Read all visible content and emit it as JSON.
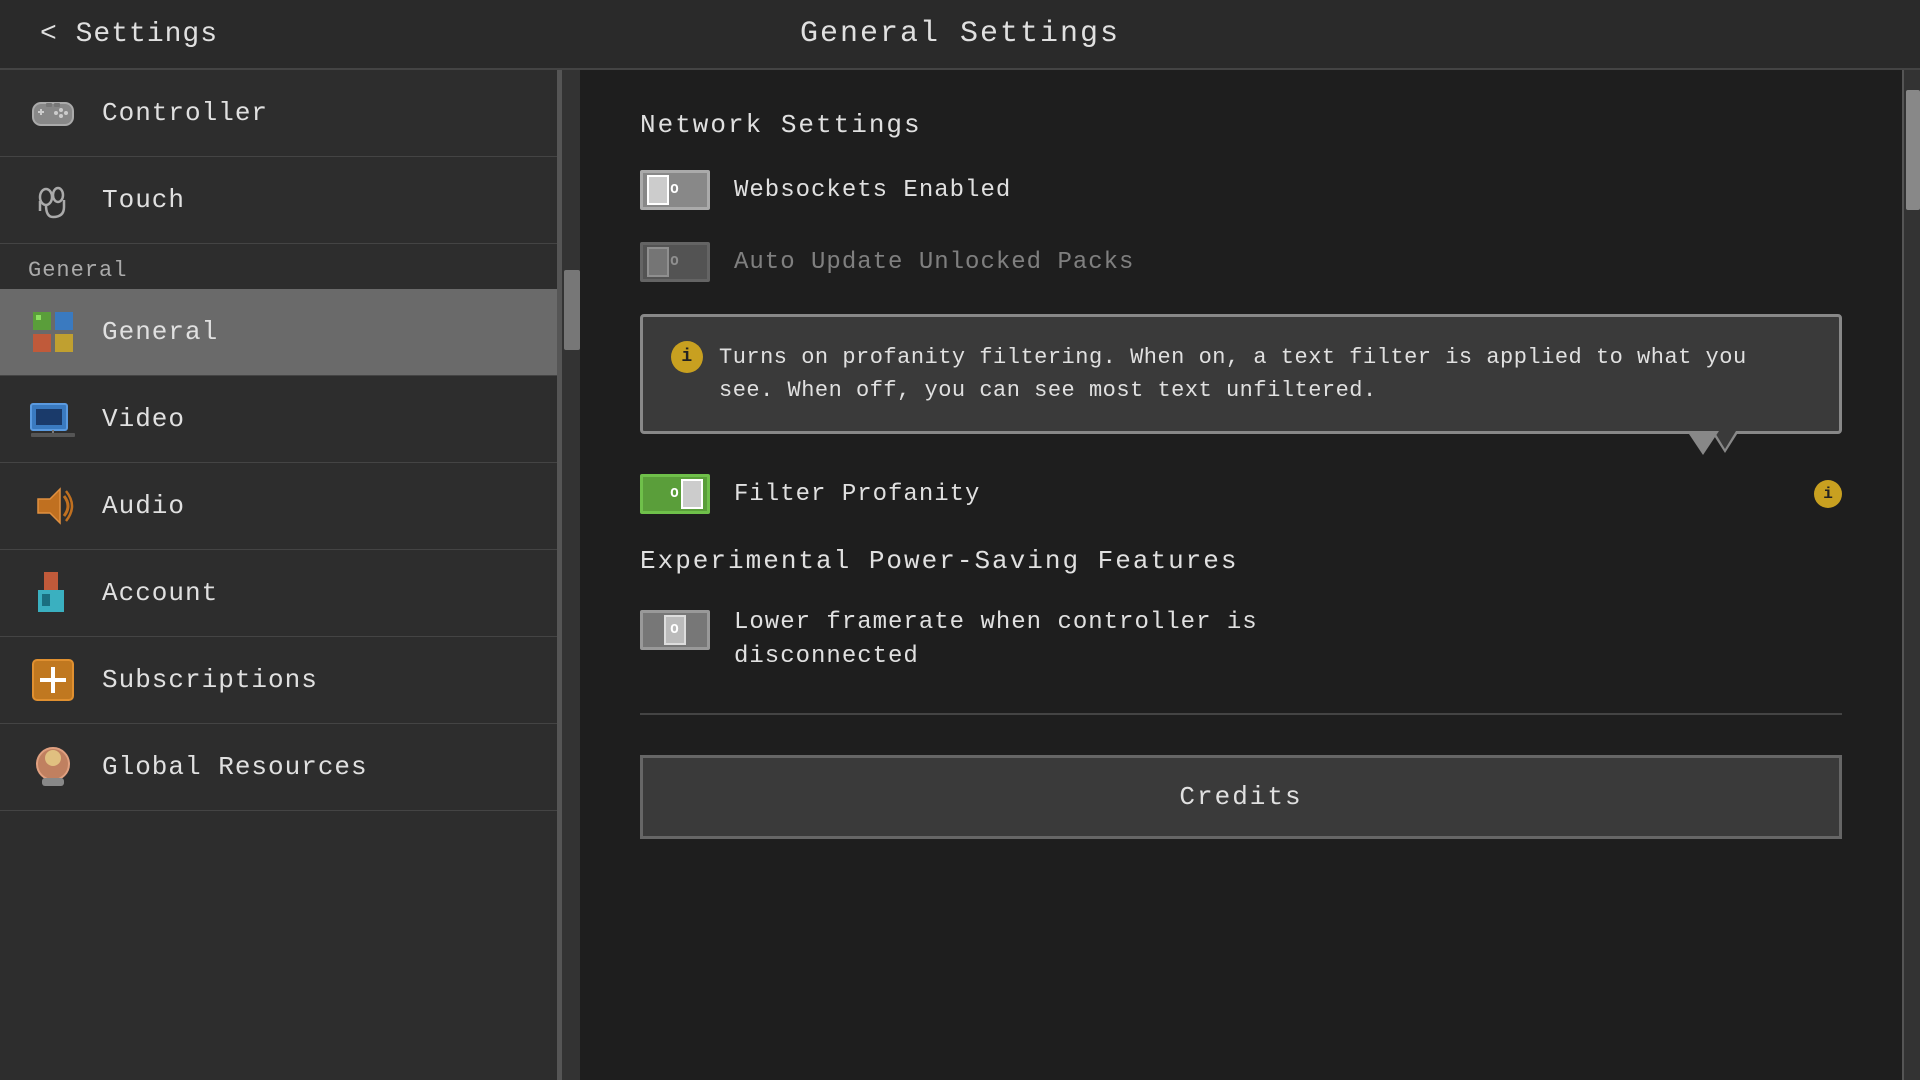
{
  "header": {
    "back_label": "< Settings",
    "title": "General Settings"
  },
  "sidebar": {
    "items_top": [
      {
        "id": "controller",
        "label": "Controller",
        "icon": "🎮"
      },
      {
        "id": "touch",
        "label": "Touch",
        "icon": "🤲"
      }
    ],
    "section_general_label": "General",
    "items_general": [
      {
        "id": "general",
        "label": "General",
        "icon": "🧊",
        "active": true
      },
      {
        "id": "video",
        "label": "Video",
        "icon": "🖥"
      },
      {
        "id": "audio",
        "label": "Audio",
        "icon": "🔊"
      },
      {
        "id": "account",
        "label": "Account",
        "icon": "🧱"
      },
      {
        "id": "subscriptions",
        "label": "Subscriptions",
        "icon": "➕"
      },
      {
        "id": "global-resources",
        "label": "Global Resources",
        "icon": "🖼"
      }
    ]
  },
  "right_panel": {
    "network_section_title": "Network Settings",
    "websockets_label": "Websockets Enabled",
    "auto_update_label": "Auto Update Unlocked Packs",
    "tooltip_text": "Turns on profanity filtering. When on, a text filter is applied to what you see. When off, you can see most text unfiltered.",
    "filter_profanity_label": "Filter Profanity",
    "experimental_section_title": "Experimental Power-Saving Features",
    "lower_framerate_label": "Lower framerate when controller is\ndisconnected",
    "credits_button_label": "Credits",
    "toggle_label": "O"
  }
}
